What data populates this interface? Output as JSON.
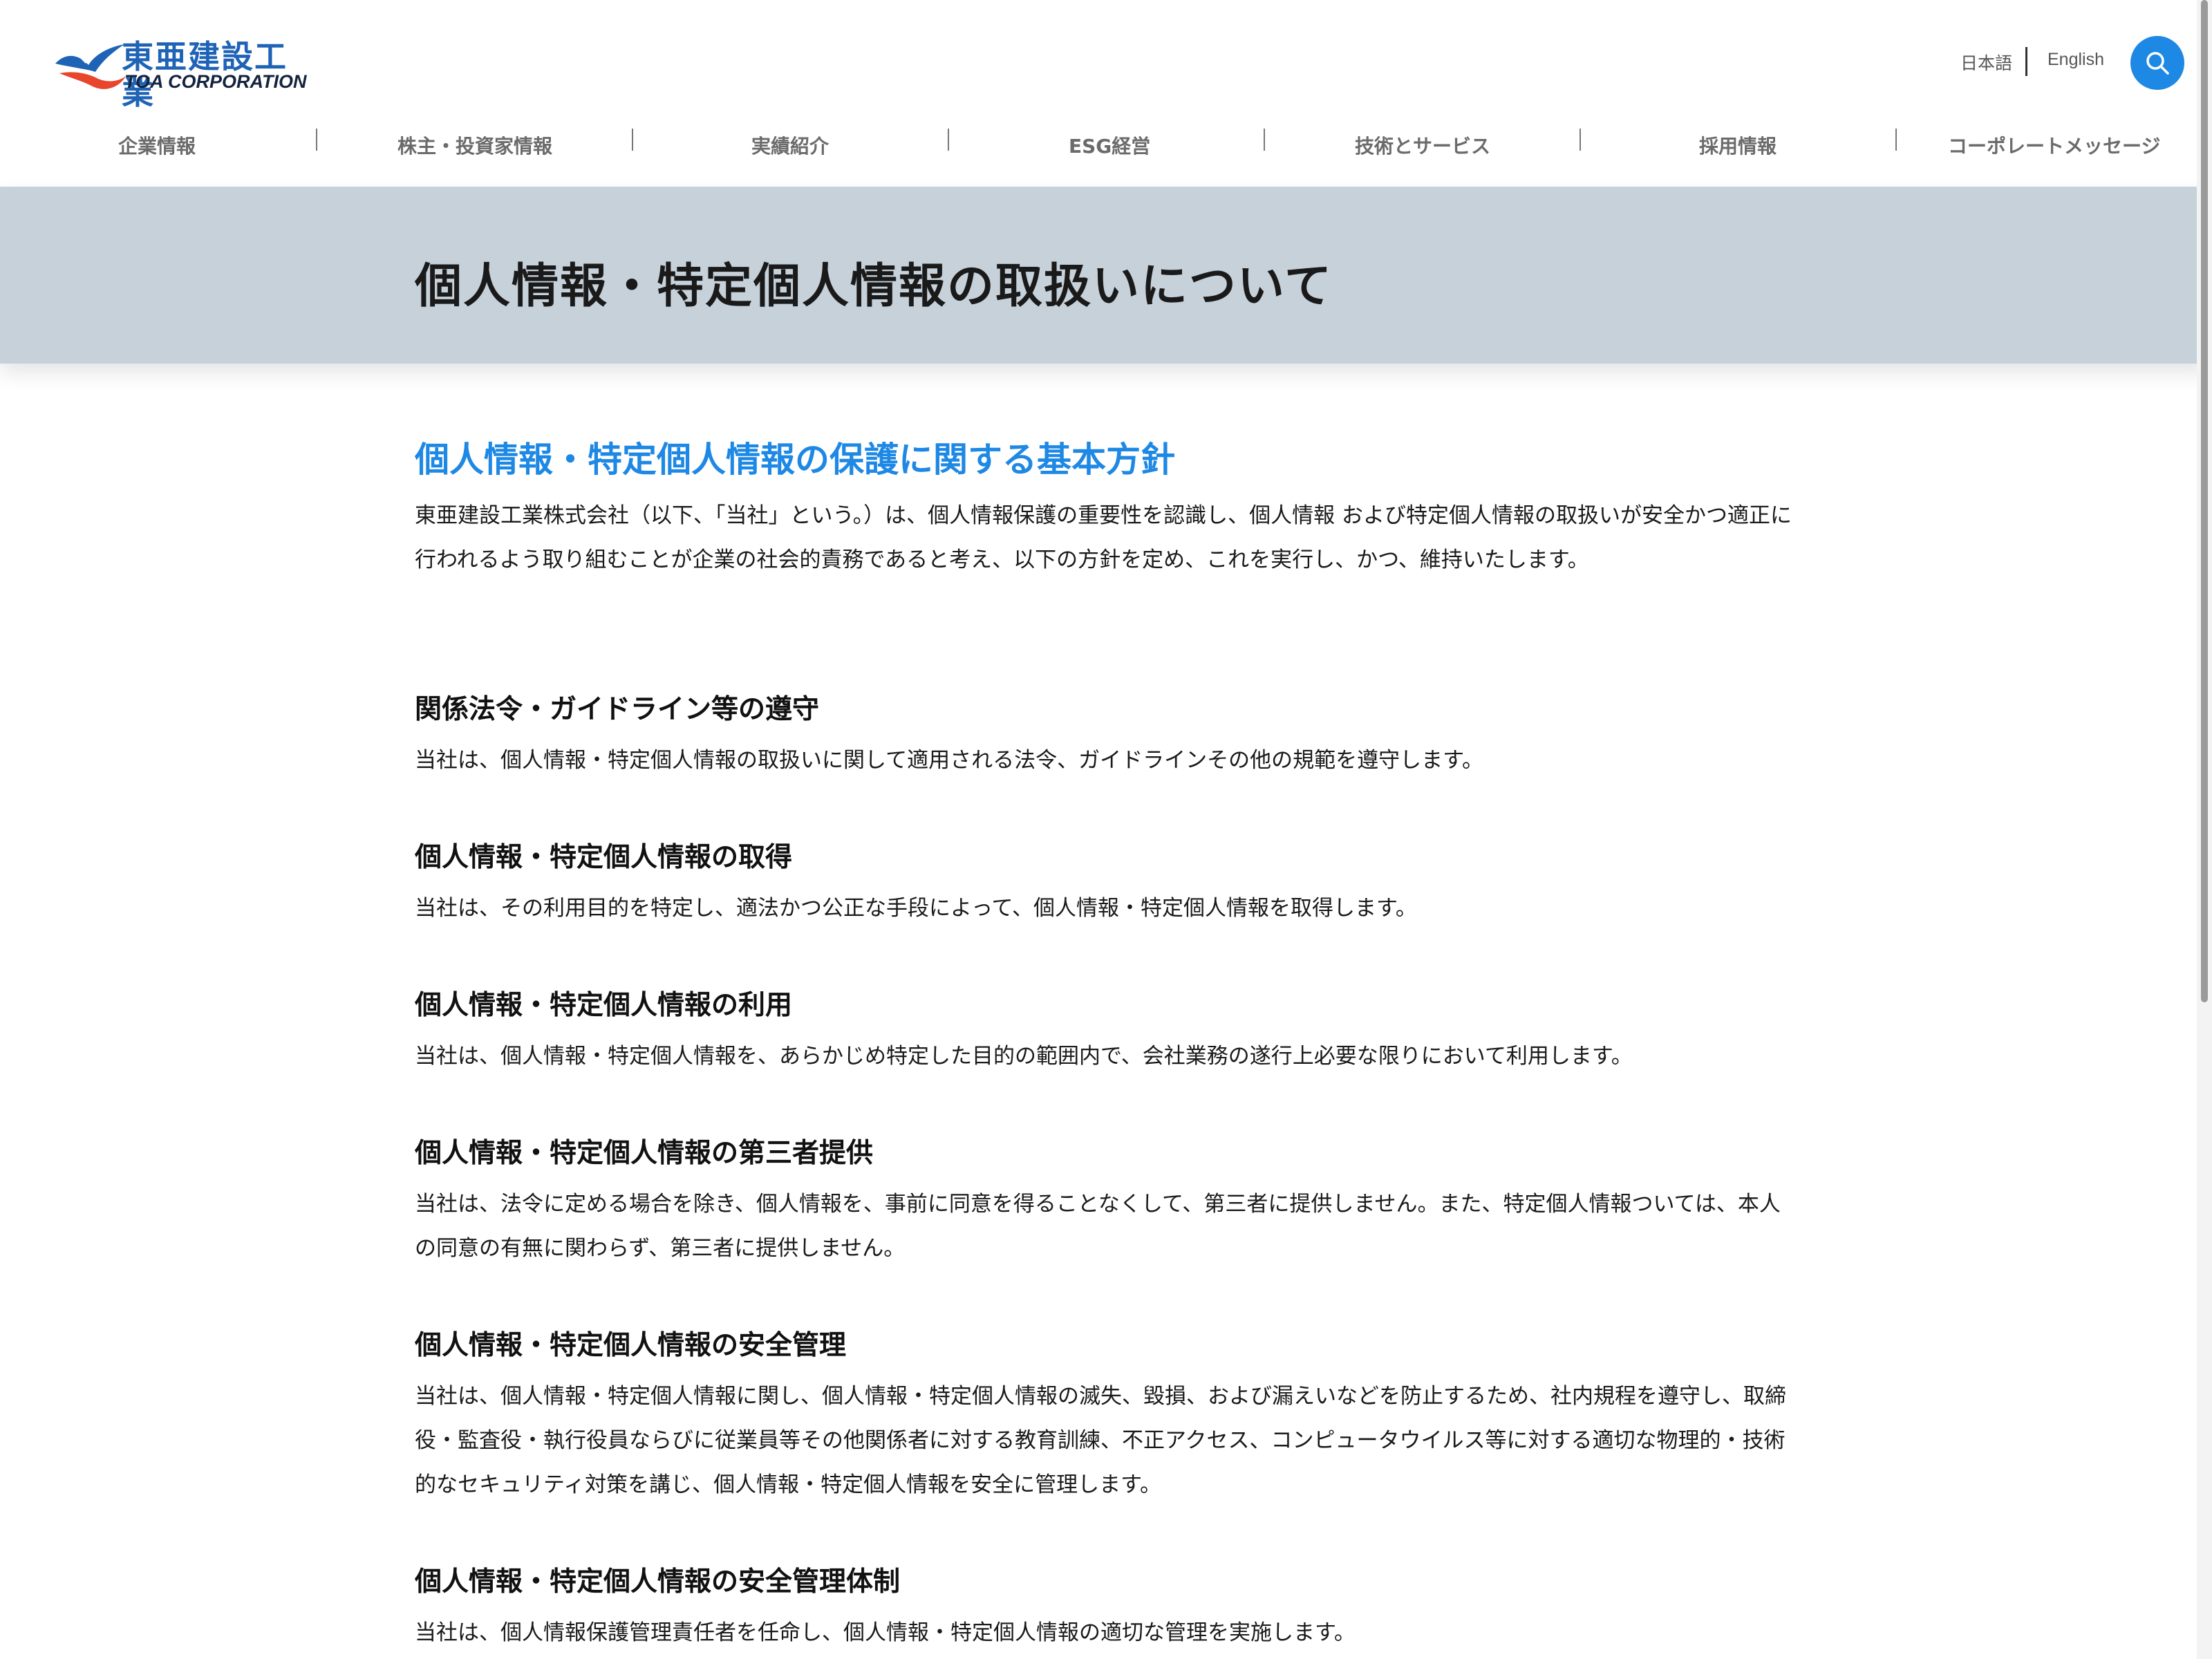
{
  "brand": {
    "logo_jp": "東亜建設工業",
    "logo_en": "TOA CORPORATION",
    "primary_color": "#1e63b6",
    "accent_color": "#1e88e5"
  },
  "header": {
    "lang_ja": "日本語",
    "lang_en": "English",
    "search_icon": "search-icon"
  },
  "nav": {
    "items": [
      {
        "label": "企業情報"
      },
      {
        "label": "株主・投資家情報"
      },
      {
        "label": "実績紹介"
      },
      {
        "label": "ESG経営"
      },
      {
        "label": "技術とサービス"
      },
      {
        "label": "採用情報"
      },
      {
        "label": "コーポレートメッセージ"
      }
    ]
  },
  "page": {
    "title": "個人情報・特定個人情報の取扱いについて",
    "title_band_color": "#c7d1da"
  },
  "policy": {
    "heading": "個人情報・特定個人情報の保護に関する基本方針",
    "intro": "東亜建設工業株式会社（以下、「当社」という。）は、個人情報保護の重要性を認識し、個人情報 および特定個人情報の取扱いが安全かつ適正に行われるよう取り組むことが企業の社会的責務であると考え、以下の方針を定め、これを実行し、かつ、維持いたします。",
    "sections": [
      {
        "heading": "関係法令・ガイドライン等の遵守",
        "body": "当社は、個人情報・特定個人情報の取扱いに関して適用される法令、ガイドラインその他の規範を遵守します。"
      },
      {
        "heading": "個人情報・特定個人情報の取得",
        "body": "当社は、その利用目的を特定し、適法かつ公正な手段によって、個人情報・特定個人情報を取得します。"
      },
      {
        "heading": "個人情報・特定個人情報の利用",
        "body": "当社は、個人情報・特定個人情報を、あらかじめ特定した目的の範囲内で、会社業務の遂行上必要な限りにおいて利用します。"
      },
      {
        "heading": "個人情報・特定個人情報の第三者提供",
        "body": "当社は、法令に定める場合を除き、個人情報を、事前に同意を得ることなくして、第三者に提供しません。また、特定個人情報ついては、本人の同意の有無に関わらず、第三者に提供しません。"
      },
      {
        "heading": "個人情報・特定個人情報の安全管理",
        "body": "当社は、個人情報・特定個人情報に関し、個人情報・特定個人情報の滅失、毀損、および漏えいなどを防止するため、社内規程を遵守し、取締役・監査役・執行役員ならびに従業員等その他関係者に対する教育訓練、不正アクセス、コンピュータウイルス等に対する適切な物理的・技術的なセキュリティ対策を講じ、個人情報・特定個人情報を安全に管理します。"
      },
      {
        "heading": "個人情報・特定個人情報の安全管理体制",
        "body": "当社は、個人情報保護管理責任者を任命し、個人情報・特定個人情報の適切な管理を実施します。"
      }
    ]
  }
}
